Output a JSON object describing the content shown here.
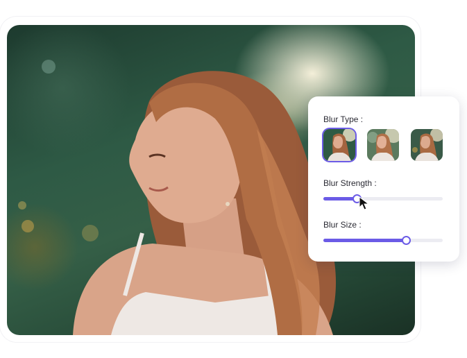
{
  "accent_color": "#6b5be6",
  "photo": {
    "subject": "woman-portrait-blurred-background"
  },
  "blur_panel": {
    "blur_type_label": "Blur Type :",
    "blur_types": [
      {
        "id": "type-1",
        "selected": true
      },
      {
        "id": "type-2",
        "selected": false
      },
      {
        "id": "type-3",
        "selected": false
      }
    ],
    "blur_strength_label": "Blur Strength :",
    "blur_strength_value": 0.28,
    "blur_size_label": "Blur Size :",
    "blur_size_value": 0.69
  },
  "icons": {
    "cursor": "arrow-cursor-icon"
  }
}
